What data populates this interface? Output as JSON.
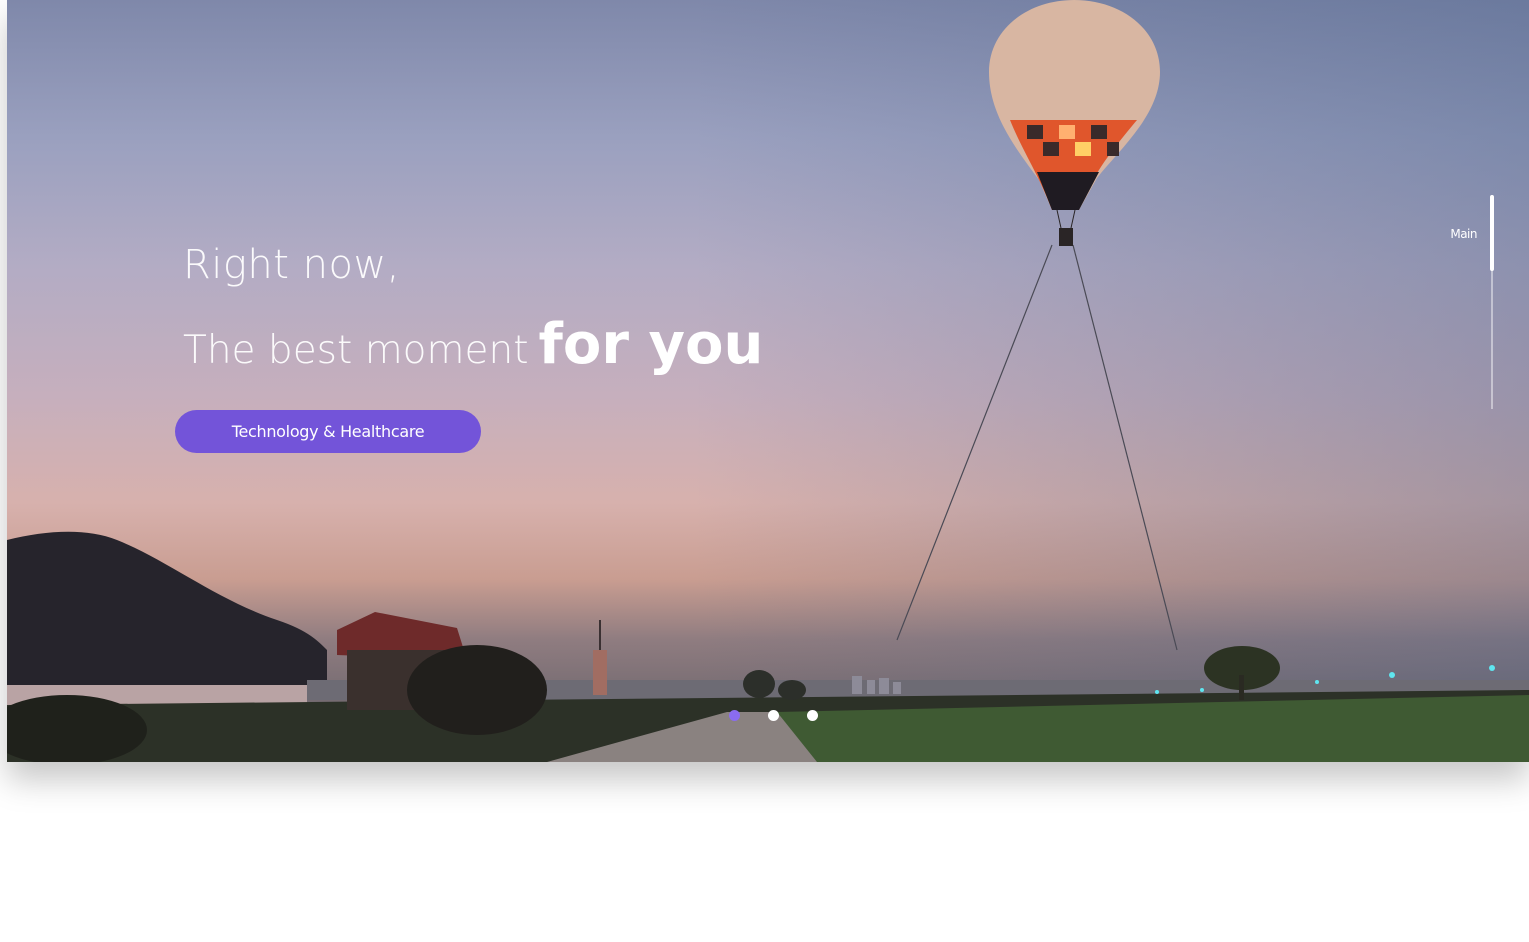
{
  "hero": {
    "line1": "Right now,",
    "line2_light": "The best moment",
    "line2_bold": "for you",
    "cta_label": "Technology & Healthcare"
  },
  "side_nav": {
    "label": "Main"
  },
  "pagination": {
    "count": 3,
    "active_index": 0
  },
  "colors": {
    "accent": "#7354d9",
    "active_dot": "#8a6cf0"
  }
}
